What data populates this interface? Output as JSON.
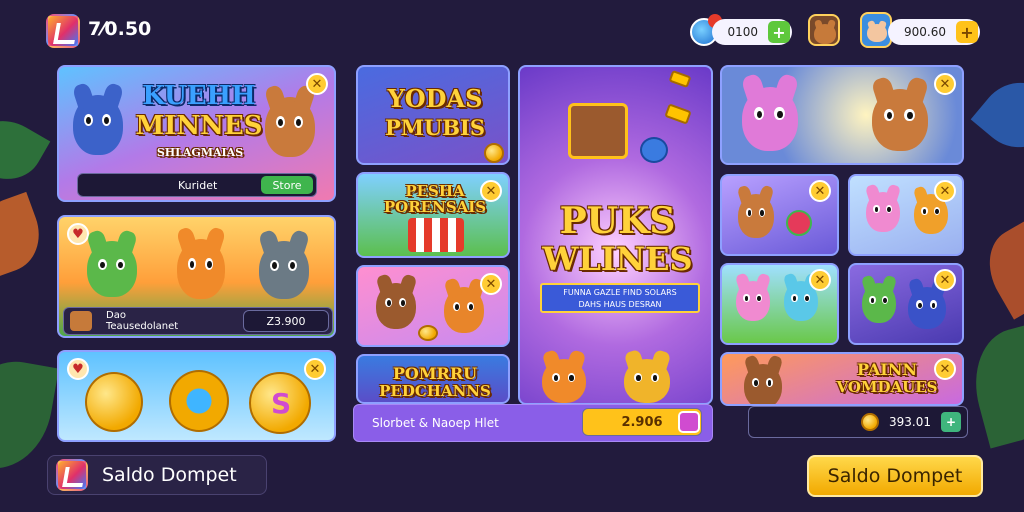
{
  "header": {
    "balance": "7⁄0.50",
    "pill_left": "0100",
    "pill_right": "900.60",
    "plus_label": "+"
  },
  "cards": {
    "kuehh": {
      "title_line1": "KUEHH",
      "title_line2": "MINNES",
      "title_line3": "SHLAGMAIAS",
      "info_label": "Kuridet",
      "button_label": "Store"
    },
    "animals": {
      "info_label_line1": "Dao",
      "info_label_line2": "Teausedolanet",
      "value": "Z3.900"
    },
    "coins": {},
    "yodas": {
      "title_line1": "YODAS",
      "title_line2": "PMUBIS"
    },
    "pesha": {
      "title_line1": "PESHA",
      "title_line2": "PORENSAIS"
    },
    "puks": {
      "title_line1": "PUKS",
      "title_line2": "WLINES",
      "ribbon_line1": "FUNNA GAZLE FIND SOLARS",
      "ribbon_line2": "DAHS HAUS DESRAN"
    },
    "pomrru": {
      "title_line1": "POMRRU",
      "title_line2": "PEDCHANNS"
    },
    "painn": {
      "title_line1": "PAINN",
      "title_line2": "VOMDAUES"
    }
  },
  "center_bar": {
    "label": "Slorbet & Naoep Hlet",
    "value": "2.906"
  },
  "right_bar": {
    "value": "393.01"
  },
  "bottom": {
    "left_button": "Saldo Dompet",
    "right_button": "Saldo Dompet"
  },
  "colors": {
    "background": "#221b3d",
    "accent_gold": "#ffc21a",
    "accent_green": "#3fb54d",
    "card_border": "#8ea0ff"
  }
}
